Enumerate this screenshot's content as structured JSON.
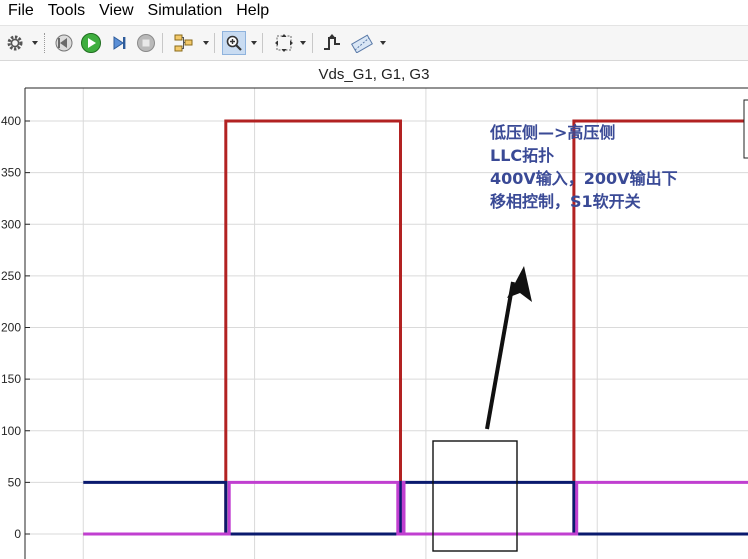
{
  "menu": {
    "items": [
      "File",
      "Tools",
      "View",
      "Simulation",
      "Help"
    ]
  },
  "toolbar": {
    "buttons": [
      {
        "name": "settings-icon"
      },
      {
        "name": "step-back-icon"
      },
      {
        "name": "run-icon",
        "color": "#2e9a2e"
      },
      {
        "name": "step-forward-icon"
      },
      {
        "name": "stop-icon"
      },
      {
        "name": "highlight-block-icon"
      },
      {
        "name": "zoom-icon",
        "pressed": true
      },
      {
        "name": "fit-to-view-icon"
      },
      {
        "name": "triggers-icon"
      },
      {
        "name": "style-icon"
      }
    ]
  },
  "annotation": {
    "lines": [
      "低压侧—>高压侧",
      "LLC拓扑",
      "400V输入，200V输出下",
      "移相控制，S1软开关"
    ],
    "color": "#3a4a96"
  },
  "chart_data": {
    "type": "line",
    "title": "Vds_G1, G1, G3",
    "xlabel": "",
    "ylabel": "",
    "ylim": [
      0,
      400
    ],
    "yticks": [
      0,
      50,
      100,
      150,
      200,
      250,
      300,
      350,
      400
    ],
    "grid": true,
    "series": [
      {
        "color": "#b22222",
        "points": [
          [
            0,
            0
          ],
          [
            0.208,
            0
          ],
          [
            0.208,
            400
          ],
          [
            0.463,
            400
          ],
          [
            0.463,
            0
          ],
          [
            0.716,
            0
          ],
          [
            0.716,
            400
          ],
          [
            1.0,
            400
          ]
        ]
      },
      {
        "color": "#0a1a6e",
        "points": [
          [
            0,
            50
          ],
          [
            0.208,
            50
          ],
          [
            0.208,
            0
          ],
          [
            0.463,
            0
          ],
          [
            0.463,
            50
          ],
          [
            0.716,
            50
          ],
          [
            0.716,
            0
          ],
          [
            1.0,
            0
          ]
        ]
      },
      {
        "color": "#c03fd0",
        "points": [
          [
            0,
            0
          ],
          [
            0.213,
            0
          ],
          [
            0.213,
            50
          ],
          [
            0.459,
            50
          ],
          [
            0.459,
            0
          ],
          [
            0.467,
            0
          ],
          [
            0.467,
            50
          ],
          [
            0.468,
            50
          ],
          [
            0.468,
            0
          ],
          [
            0.72,
            0
          ],
          [
            0.72,
            50
          ],
          [
            1.0,
            50
          ]
        ]
      }
    ],
    "xgrid": [
      0.0,
      0.25,
      0.5,
      0.75,
      1.0
    ],
    "xrange": [
      -0.085,
      0.97
    ]
  }
}
